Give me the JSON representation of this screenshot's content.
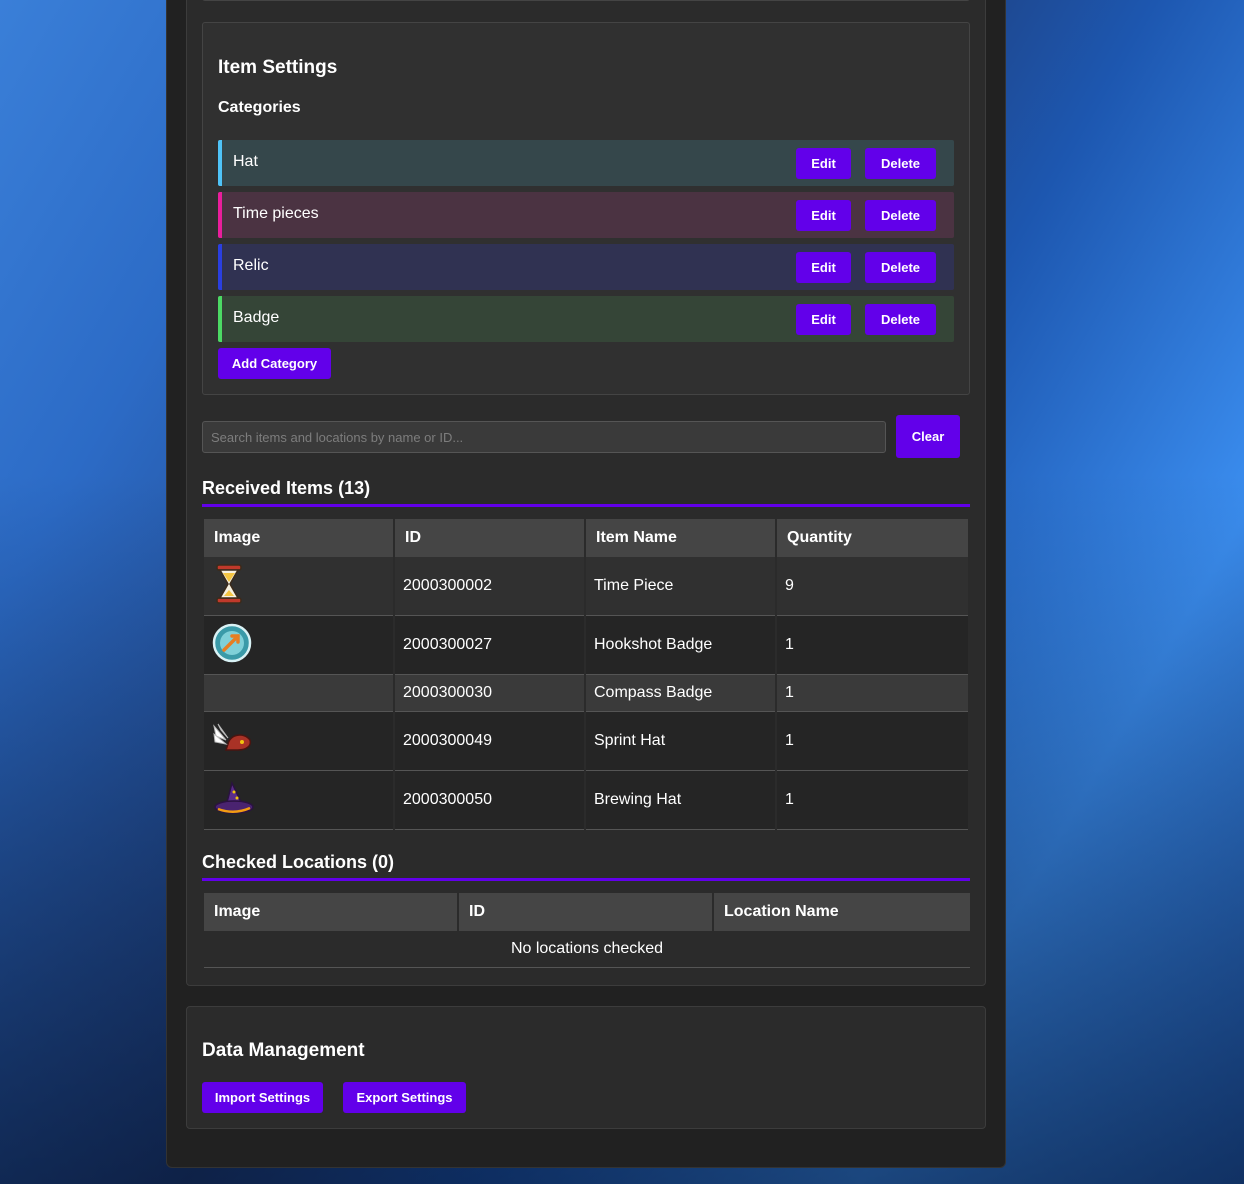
{
  "item_settings": {
    "title": "Item Settings",
    "categories_title": "Categories",
    "categories": [
      {
        "name": "Hat",
        "accent": "#4fc3f7",
        "bg": "#35474b"
      },
      {
        "name": "Time pieces",
        "accent": "#e91e9c",
        "bg": "#4b3342"
      },
      {
        "name": "Relic",
        "accent": "#2a3fe0",
        "bg": "#303252"
      },
      {
        "name": "Badge",
        "accent": "#4cd964",
        "bg": "#354537"
      }
    ],
    "edit_label": "Edit",
    "delete_label": "Delete",
    "add_category_label": "Add Category"
  },
  "search": {
    "placeholder": "Search items and locations by name or ID...",
    "clear_label": "Clear"
  },
  "received": {
    "title": "Received Items (13)",
    "headers": [
      "Image",
      "ID",
      "Item Name",
      "Quantity"
    ],
    "rows": [
      {
        "icon": "hourglass-icon",
        "id": "2000300002",
        "name": "Time Piece",
        "qty": "9"
      },
      {
        "icon": "hookshot-badge-icon",
        "id": "2000300027",
        "name": "Hookshot Badge",
        "qty": "1"
      },
      {
        "icon": "",
        "id": "2000300030",
        "name": "Compass Badge",
        "qty": "1"
      },
      {
        "icon": "sprint-hat-icon",
        "id": "2000300049",
        "name": "Sprint Hat",
        "qty": "1"
      },
      {
        "icon": "brewing-hat-icon",
        "id": "2000300050",
        "name": "Brewing Hat",
        "qty": "1"
      }
    ]
  },
  "checked": {
    "title": "Checked Locations (0)",
    "headers": [
      "Image",
      "ID",
      "Location Name"
    ],
    "empty_text": "No locations checked"
  },
  "data_management": {
    "title": "Data Management",
    "import_label": "Import Settings",
    "export_label": "Export Settings"
  },
  "colors": {
    "accent": "#6200ea"
  }
}
